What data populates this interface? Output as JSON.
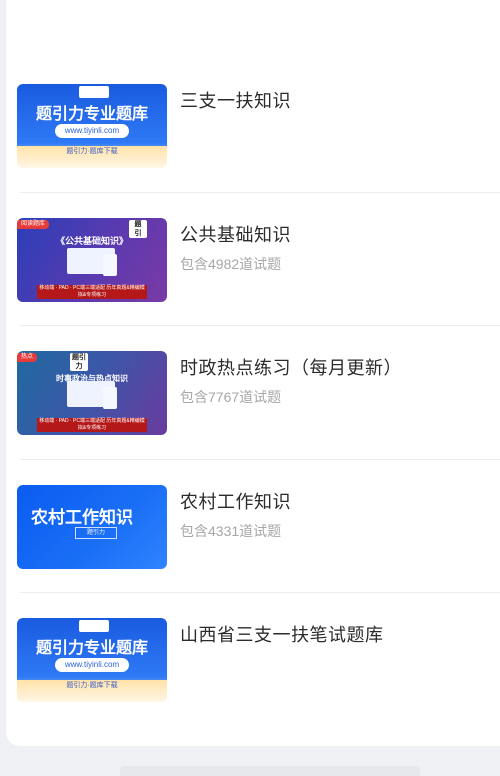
{
  "list": {
    "items": [
      {
        "title": "三支一扶知识",
        "subtitle": "",
        "thumb": {
          "kind": "blue-brand",
          "heading": "题引力专业题库",
          "url": "www.tiyinli.com",
          "footer": "题引力·题库下载"
        }
      },
      {
        "title": "公共基础知识",
        "subtitle": "包含4982道试题",
        "thumb": {
          "kind": "purple-topic",
          "badge": "阅读题库",
          "heading": "《公共基础知识》",
          "band": "移动端 · PAD · PC端三端适配\n历年真题&精编模拟&专项练习"
        }
      },
      {
        "title": "时政热点练习（每月更新）",
        "subtitle": "包含7767道试题",
        "thumb": {
          "kind": "teal-topic",
          "badge": "题引力",
          "heading": "时事政治与热点知识",
          "band": "移动端 · PAD · PC端三端适配\n历年真题&精编模拟&专项练习"
        }
      },
      {
        "title": "农村工作知识",
        "subtitle": "包含4331道试题",
        "thumb": {
          "kind": "rural",
          "heading": "农村工作知识",
          "box": "题引力"
        }
      },
      {
        "title": "山西省三支一扶笔试题库",
        "subtitle": "",
        "thumb": {
          "kind": "blue-brand",
          "heading": "题引力专业题库",
          "url": "www.tiyinli.com",
          "footer": "题引力·题库下载"
        }
      }
    ]
  },
  "colors": {
    "title": "#2b2b2b",
    "subtitle": "#a7a7a7",
    "background": "#eef0f3"
  }
}
